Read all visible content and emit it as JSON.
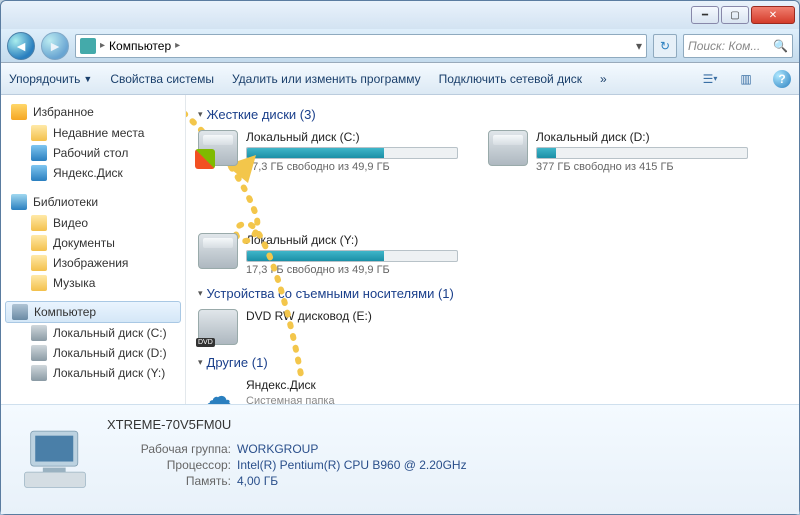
{
  "titlebar": {},
  "address": {
    "location": "Компьютер",
    "search_placeholder": "Поиск: Ком..."
  },
  "toolbar": {
    "organize": "Упорядочить",
    "properties": "Свойства системы",
    "uninstall": "Удалить или изменить программу",
    "network_drive": "Подключить сетевой диск",
    "more": "»"
  },
  "sidebar": {
    "favorites": "Избранное",
    "fav_items": [
      {
        "label": "Недавние места"
      },
      {
        "label": "Рабочий стол"
      },
      {
        "label": "Яндекс.Диск"
      }
    ],
    "libraries": "Библиотеки",
    "lib_items": [
      {
        "label": "Видео"
      },
      {
        "label": "Документы"
      },
      {
        "label": "Изображения"
      },
      {
        "label": "Музыка"
      }
    ],
    "computer": "Компьютер",
    "comp_items": [
      {
        "label": "Локальный диск (C:)"
      },
      {
        "label": "Локальный диск (D:)"
      },
      {
        "label": "Локальный диск (Y:)"
      }
    ]
  },
  "content": {
    "hdd_header": "Жесткие диски (3)",
    "drives": [
      {
        "name": "Локальный диск (C:)",
        "free": "17,3 ГБ свободно из 49,9 ГБ",
        "fill": 65,
        "os": true
      },
      {
        "name": "Локальный диск (D:)",
        "free": "377 ГБ свободно из 415 ГБ",
        "fill": 9,
        "os": false
      },
      {
        "name": "Локальный диск (Y:)",
        "free": "17,3 ГБ свободно из 49,9 ГБ",
        "fill": 65,
        "os": false
      }
    ],
    "removable_header": "Устройства со съемными носителями (1)",
    "dvd_name": "DVD RW дисковод (E:)",
    "other_header": "Другие (1)",
    "cloud_name": "Яндекс.Диск",
    "cloud_sub": "Системная папка"
  },
  "details": {
    "computer_name": "XTREME-70V5FM0U",
    "workgroup_label": "Рабочая группа:",
    "workgroup_value": "WORKGROUP",
    "cpu_label": "Процессор:",
    "cpu_value": "Intel(R) Pentium(R) CPU B960 @ 2.20GHz",
    "ram_label": "Память:",
    "ram_value": "4,00 ГБ"
  }
}
